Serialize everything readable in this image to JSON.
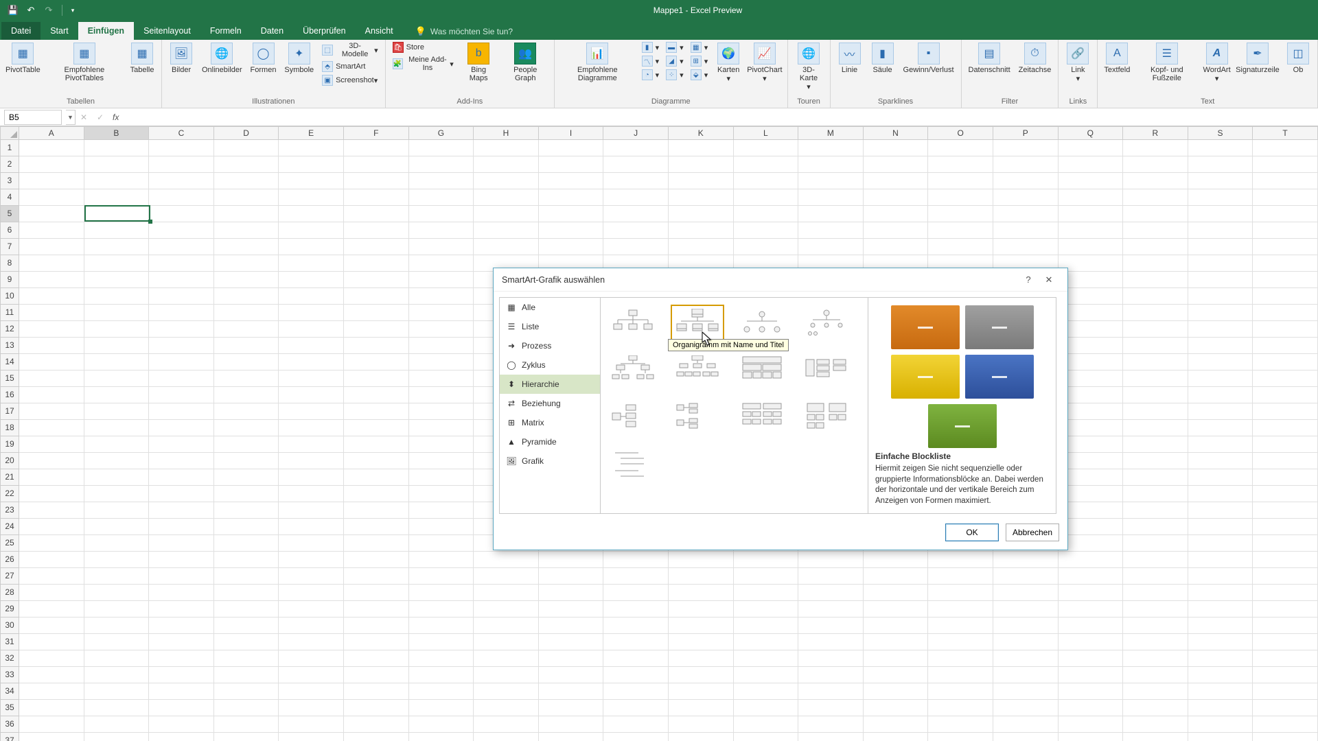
{
  "titlebar": {
    "doc": "Mappe1",
    "app": "Excel Preview",
    "sep": "  -  "
  },
  "tabs": {
    "file": "Datei",
    "home": "Start",
    "insert": "Einfügen",
    "layout": "Seitenlayout",
    "formulas": "Formeln",
    "data": "Daten",
    "review": "Überprüfen",
    "view": "Ansicht",
    "tellme_placeholder": "Was möchten Sie tun?"
  },
  "ribbon": {
    "groups": {
      "tables": "Tabellen",
      "illustrations": "Illustrationen",
      "addins": "Add-Ins",
      "charts": "Diagramme",
      "sparklines": "Sparklines",
      "filter": "Filter",
      "links": "Links",
      "text": "Text"
    },
    "btns": {
      "pivottable": "PivotTable",
      "recommended_pivot": "Empfohlene PivotTables",
      "table": "Tabelle",
      "pictures": "Bilder",
      "online_pictures": "Onlinebilder",
      "shapes": "Formen",
      "icons": "Symbole",
      "models_3d": "3D-Modelle",
      "smartart": "SmartArt",
      "screenshot": "Screenshot",
      "store": "Store",
      "my_addins": "Meine Add-Ins",
      "bing_maps": "Bing Maps",
      "people_graph": "People Graph",
      "recommended_charts": "Empfohlene Diagramme",
      "maps": "Karten",
      "pivotchart": "PivotChart",
      "map3d": "3D-Karte",
      "tours": "Touren",
      "spark_line": "Linie",
      "spark_column": "Säule",
      "spark_winloss": "Gewinn/Verlust",
      "slicer": "Datenschnitt",
      "timeline": "Zeitachse",
      "link": "Link",
      "textbox": "Textfeld",
      "header_footer": "Kopf- und Fußzeile",
      "wordart": "WordArt",
      "signature": "Signaturzeile",
      "object": "Ob"
    }
  },
  "namebox": {
    "value": "B5"
  },
  "columns": [
    "A",
    "B",
    "C",
    "D",
    "E",
    "F",
    "G",
    "H",
    "I",
    "J",
    "K",
    "L",
    "M",
    "N",
    "O",
    "P",
    "Q",
    "R",
    "S",
    "T"
  ],
  "row_count": 40,
  "selected": {
    "col": "B",
    "row": 5
  },
  "dialog": {
    "title": "SmartArt-Grafik auswählen",
    "categories": [
      {
        "key": "all",
        "label": "Alle"
      },
      {
        "key": "list",
        "label": "Liste"
      },
      {
        "key": "process",
        "label": "Prozess"
      },
      {
        "key": "cycle",
        "label": "Zyklus"
      },
      {
        "key": "hierarchy",
        "label": "Hierarchie"
      },
      {
        "key": "relationship",
        "label": "Beziehung"
      },
      {
        "key": "matrix",
        "label": "Matrix"
      },
      {
        "key": "pyramid",
        "label": "Pyramide"
      },
      {
        "key": "picture",
        "label": "Grafik"
      }
    ],
    "selected_category": "hierarchy",
    "hover_tooltip": "Organigramm mit Name und Titel",
    "preview": {
      "title": "Einfache Blockliste",
      "desc": "Hiermit zeigen Sie nicht sequenzielle oder gruppierte Informationsblöcke an. Dabei werden der horizontale und der vertikale Bereich zum Anzeigen von Formen maximiert.",
      "blocks": [
        {
          "color": "#d97a1a"
        },
        {
          "color": "#8c8c8c"
        },
        {
          "color": "#e7c61a"
        },
        {
          "color": "#3a63b0"
        },
        {
          "color": "#6a9a2d"
        }
      ]
    },
    "buttons": {
      "ok": "OK",
      "cancel": "Abbrechen"
    }
  }
}
